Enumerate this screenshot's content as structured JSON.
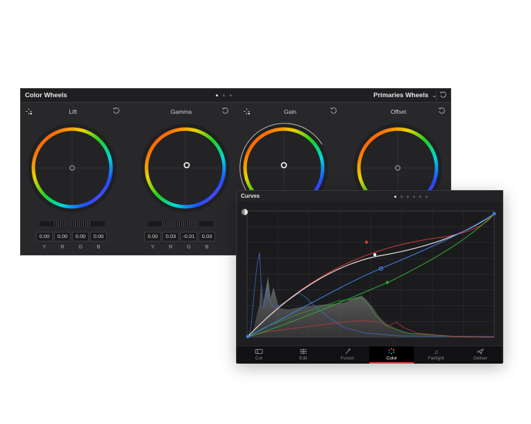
{
  "color_wheels": {
    "title": "Color Wheels",
    "mode": "Primaries Wheels",
    "wheels": [
      {
        "label": "Lift",
        "values": [
          "0.00",
          "0.00",
          "0.00",
          "0.00"
        ]
      },
      {
        "label": "Gamma",
        "values": [
          "0.00",
          "0.03",
          "-0.01",
          "0.03"
        ]
      },
      {
        "label": "Gain"
      },
      {
        "label": "Offset"
      }
    ],
    "channels": [
      "Y",
      "R",
      "G",
      "B"
    ]
  },
  "curves": {
    "title": "Curves"
  },
  "pages": [
    {
      "label": "Cut",
      "icon": "cut-page-icon"
    },
    {
      "label": "Edit",
      "icon": "edit-page-icon"
    },
    {
      "label": "Fusion",
      "icon": "fusion-page-icon"
    },
    {
      "label": "Color",
      "icon": "color-page-icon",
      "active": true
    },
    {
      "label": "Fairlight",
      "icon": "fairlight-page-icon"
    },
    {
      "label": "Deliver",
      "icon": "deliver-page-icon"
    }
  ],
  "colors": {
    "panel_bg": "#28282b",
    "curve_red": "#d23c3c",
    "curve_green": "#2fa52f",
    "curve_blue": "#3f7fe0",
    "curve_luma": "#e6e6e6",
    "active_page": "#e0484c"
  }
}
